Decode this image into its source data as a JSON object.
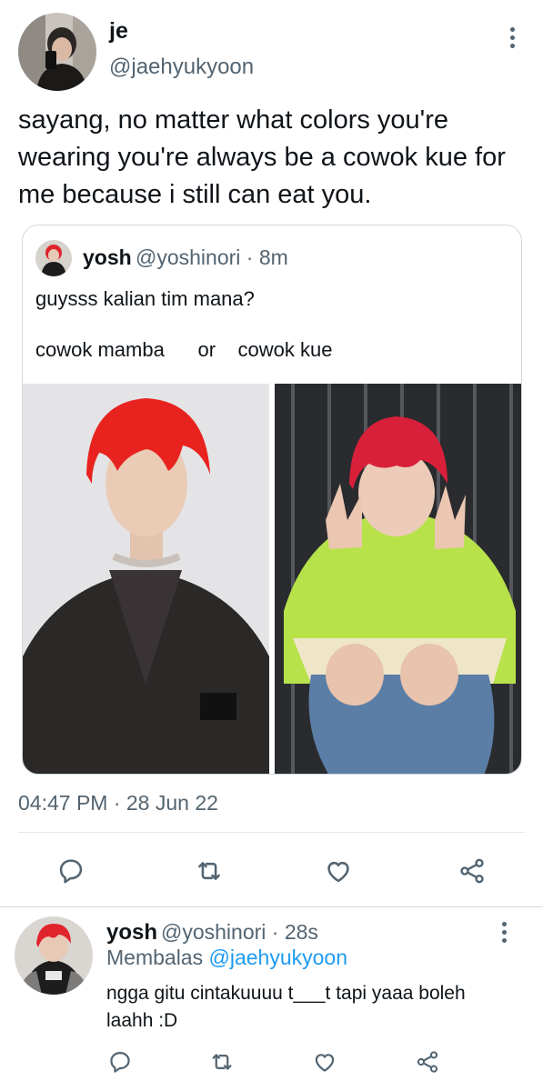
{
  "main_tweet": {
    "display_name": "je",
    "handle": "@jaehyukyoon",
    "text": "sayang, no matter what colors you're wearing you're always be a cowok kue for me because i still can eat you.",
    "timestamp": "04:47 PM · 28 Jun 22",
    "more_icon": "more-vertical-icon"
  },
  "quoted_tweet": {
    "display_name": "yosh",
    "handle_time": "@yoshinori · 8m",
    "text_line1": "guysss kalian tim mana?",
    "text_line2": "cowok mamba      or    cowok kue"
  },
  "actions": {
    "icons": [
      "reply-icon",
      "retweet-icon",
      "like-icon",
      "share-icon"
    ],
    "icon_color": "#536471"
  },
  "reply_tweet": {
    "display_name": "yosh",
    "handle_time": "@yoshinori · 28s",
    "replying_prefix": "Membalas",
    "replying_to": "@jaehyukyoon",
    "text": "ngga gitu cintakuuuu t___t tapi yaaa boleh laahh :D"
  },
  "colors": {
    "text_primary": "#0f1419",
    "text_secondary": "#536471",
    "link": "#1d9bf0",
    "border": "#cfd9de"
  }
}
